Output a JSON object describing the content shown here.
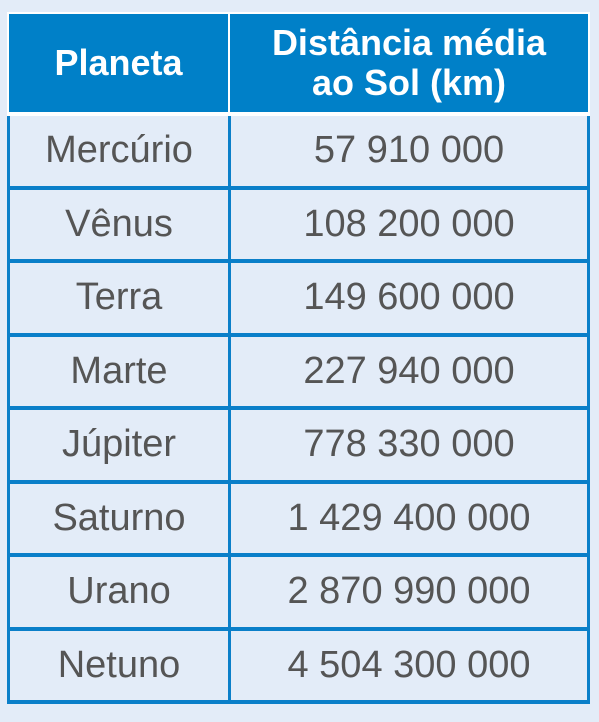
{
  "headers": {
    "planet": "Planeta",
    "distance_line1": "Distância média",
    "distance_line2": "ao Sol (km)"
  },
  "rows": [
    {
      "planet": "Mercúrio",
      "distance": "57 910 000"
    },
    {
      "planet": "Vênus",
      "distance": "108 200 000"
    },
    {
      "planet": "Terra",
      "distance": "149 600 000"
    },
    {
      "planet": "Marte",
      "distance": "227 940 000"
    },
    {
      "planet": "Júpiter",
      "distance": "778 330 000"
    },
    {
      "planet": "Saturno",
      "distance": "1 429 400 000"
    },
    {
      "planet": "Urano",
      "distance": "2 870 990 000"
    },
    {
      "planet": "Netuno",
      "distance": "4 504 300 000"
    }
  ],
  "colors": {
    "header_bg": "#0080c8",
    "border": "#0a7fc9",
    "body_bg": "#e3ecf8",
    "text": "#555555"
  }
}
